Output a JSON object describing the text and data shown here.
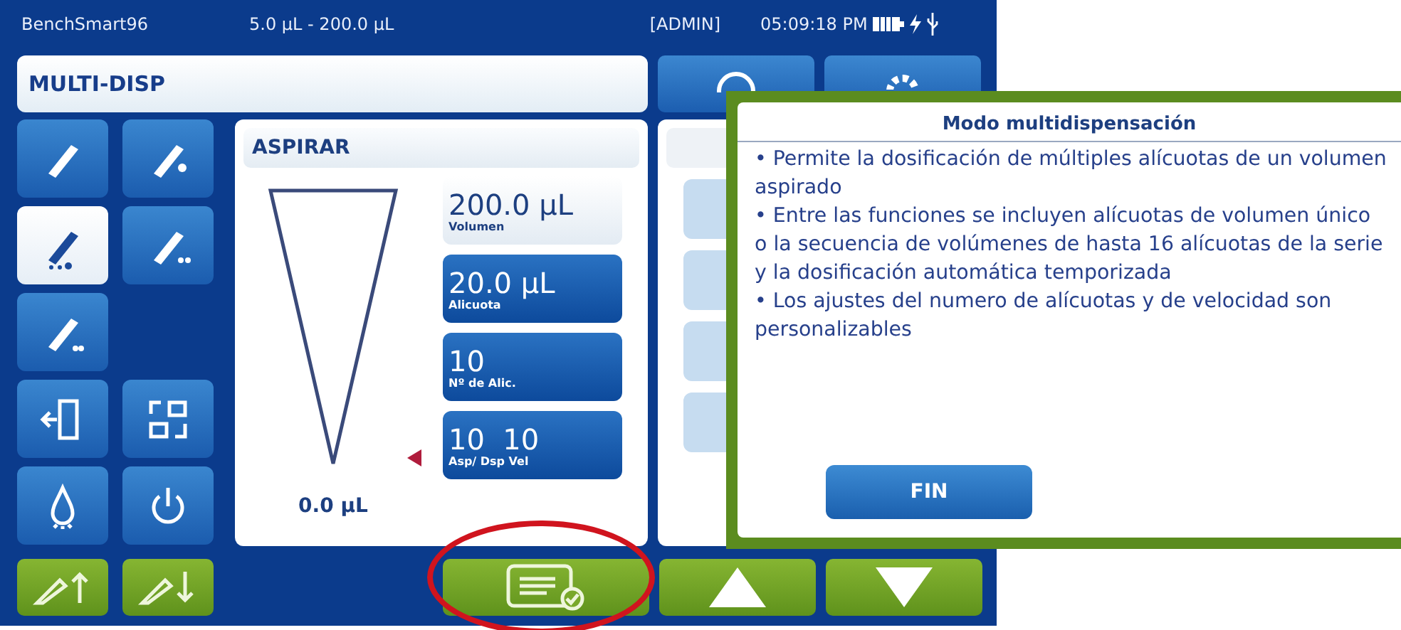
{
  "status_bar": {
    "device_name": "BenchSmart96",
    "volume_range": "5.0 µL - 200.0 µL",
    "user": "[ADMIN]",
    "time": "05:09:18 PM"
  },
  "mode_title": "MULTI-DISP",
  "header_buttons": [
    {
      "kind": "help"
    },
    {
      "kind": "settings"
    }
  ],
  "tool_rows": [
    [
      {
        "kind": "pipette",
        "selected": false
      },
      {
        "kind": "pipette-plus",
        "selected": false
      }
    ],
    [
      {
        "kind": "multi-dispense",
        "selected": true
      },
      {
        "kind": "pipette-dots",
        "selected": false
      }
    ],
    [
      {
        "kind": "pipette-reverse",
        "selected": false
      }
    ],
    [
      {
        "kind": "exit",
        "selected": false
      },
      {
        "kind": "layout",
        "selected": false
      }
    ],
    [
      {
        "kind": "drop",
        "selected": false
      },
      {
        "kind": "power",
        "selected": false
      }
    ]
  ],
  "panel": {
    "title": "ASPIRAR",
    "tip": {
      "reading": "0.0 µL"
    },
    "fields": [
      {
        "value": "200.0 µL",
        "label": "Volumen",
        "selected": true
      },
      {
        "value": "20.0 µL",
        "label": "Alicuota",
        "selected": false
      },
      {
        "value": "10",
        "label": "Nº de Alic.",
        "selected": false
      },
      {
        "value": "10  10",
        "label": "Asp/ Dsp Vel",
        "selected": false
      }
    ]
  },
  "bottom_buttons": [
    {
      "kind": "tip-up"
    },
    {
      "kind": "tip-down"
    },
    {
      "kind": "confirm"
    },
    {
      "kind": "up"
    },
    {
      "kind": "down"
    }
  ],
  "popup": {
    "title": "Modo multidispensación",
    "items": [
      "• Permite la dosificación de múltiples alícuotas de un volumen aspirado",
      "• Entre las funciones se incluyen alícuotas de volumen único o la secuencia de volúmenes de hasta 16 alícuotas de la serie y la dosificación automática temporizada",
      "• Los ajustes del numero de alícuotas y de velocidad son personalizables"
    ],
    "button": "FIN"
  }
}
